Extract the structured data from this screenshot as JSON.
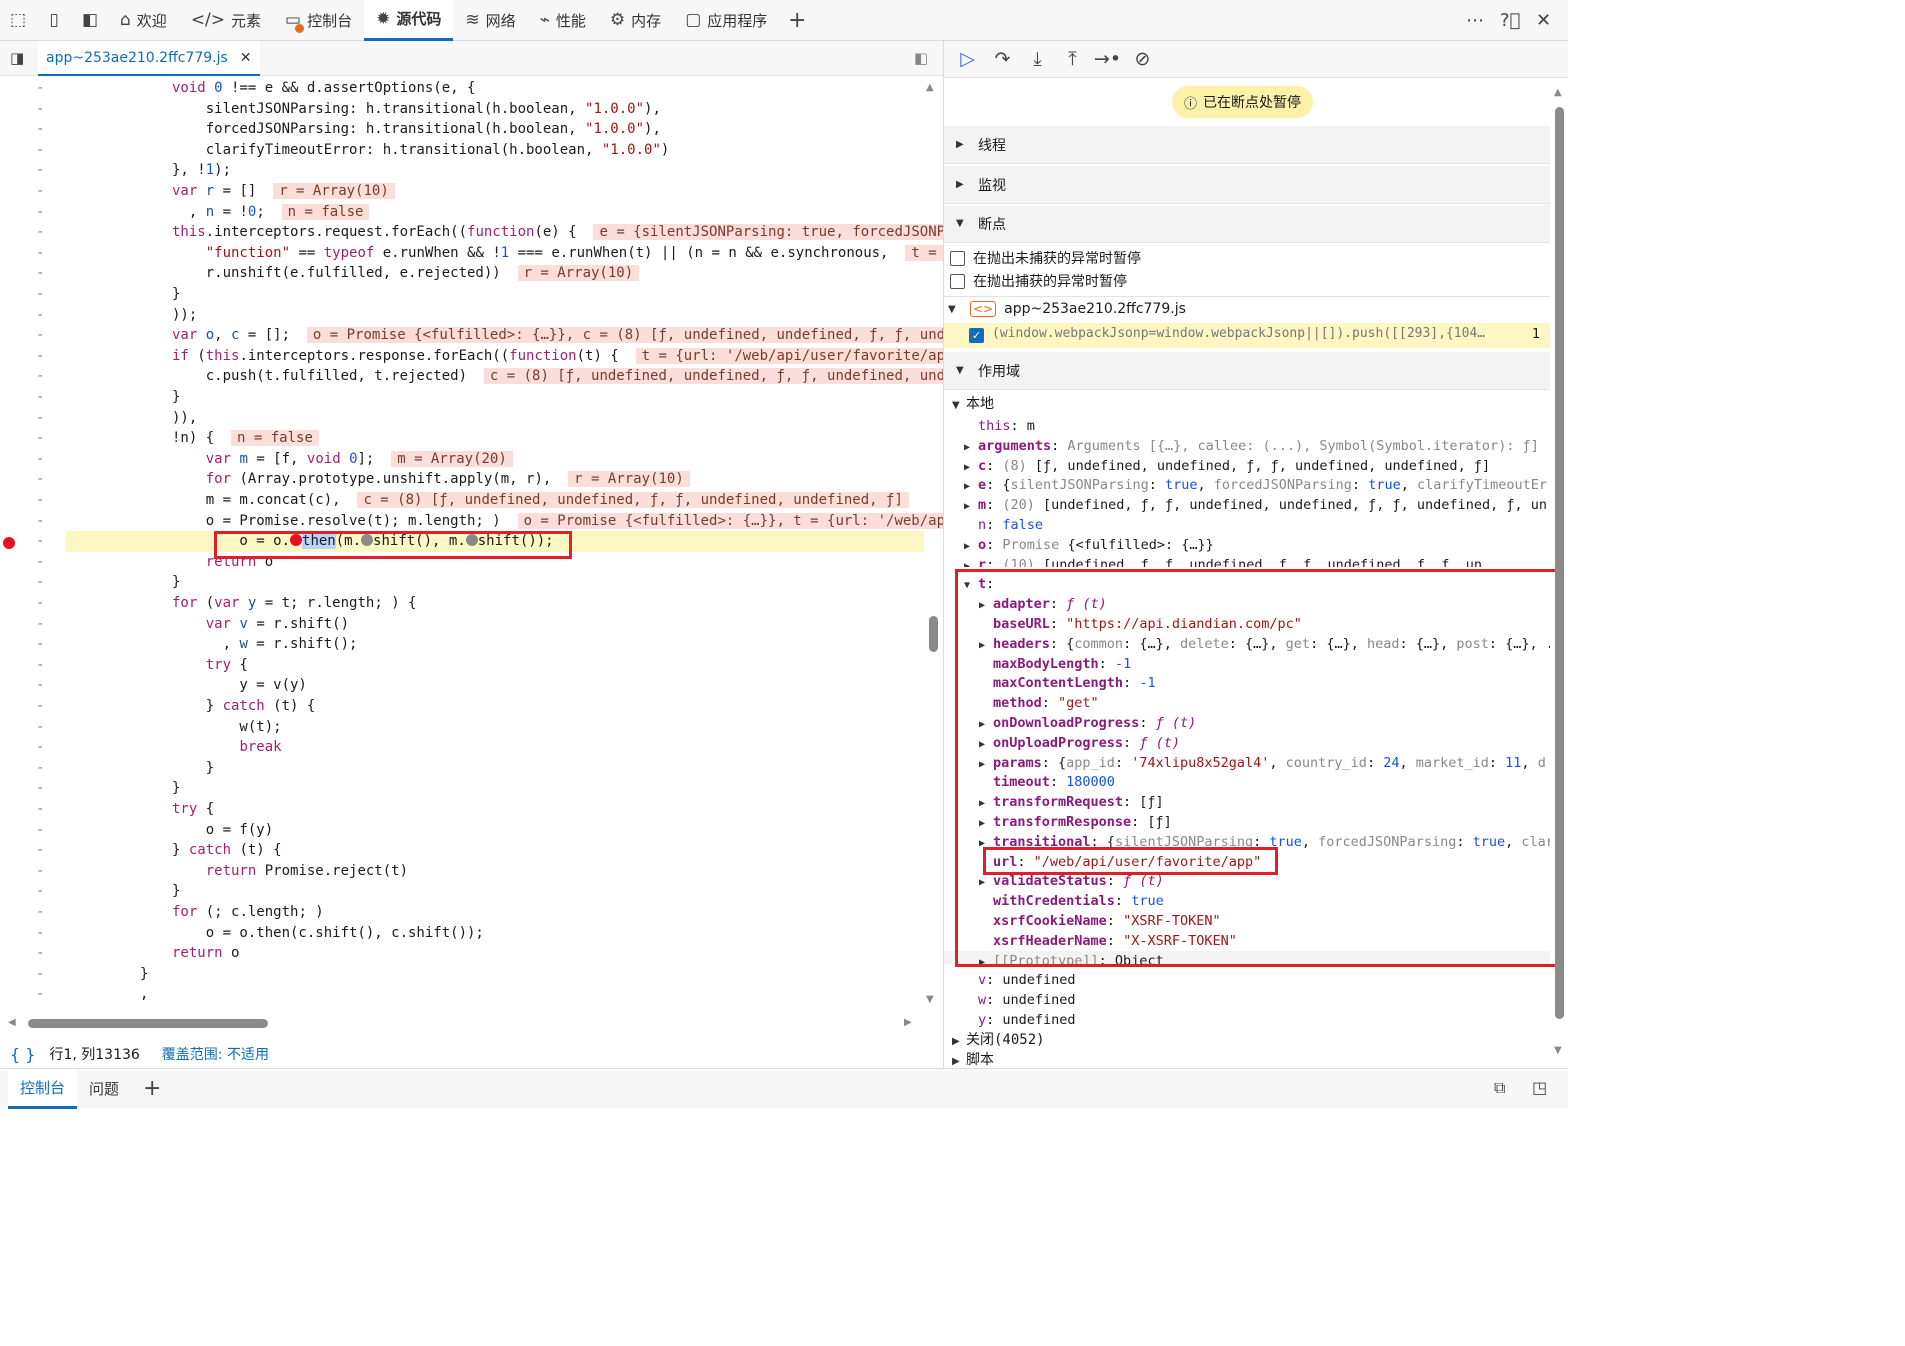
{
  "toolbar": {
    "tabs": [
      {
        "label": "欢迎",
        "icon": "home-icon",
        "glyph": "⌂"
      },
      {
        "label": "元素",
        "icon": "code-tag-icon",
        "glyph": "</>"
      },
      {
        "label": "控制台",
        "icon": "console-icon",
        "glyph": "▭"
      },
      {
        "label": "源代码",
        "icon": "bug-icon",
        "glyph": "✹"
      },
      {
        "label": "网络",
        "icon": "wifi-icon",
        "glyph": "≋"
      },
      {
        "label": "性能",
        "icon": "performance-icon",
        "glyph": "⌁"
      },
      {
        "label": "内存",
        "icon": "memory-icon",
        "glyph": "⚙"
      },
      {
        "label": "应用程序",
        "icon": "application-icon",
        "glyph": "▢"
      }
    ],
    "active_tab": "源代码",
    "add_tab": "+"
  },
  "file_tab": {
    "name": "app~253ae210.2ffc779.js",
    "close": "✕"
  },
  "code_lines": [
    {
      "html": "<span class=\"kw\">void</span> <span class=\"num\">0</span> !== e && d.assertOptions(e, {"
    },
    {
      "html": "    silentJSONParsing: h.transitional(h.boolean, <span class=\"str\">\"1.0.0\"</span>),"
    },
    {
      "html": "    forcedJSONParsing: h.transitional(h.boolean, <span class=\"str\">\"1.0.0\"</span>),"
    },
    {
      "html": "    clarifyTimeoutError: h.transitional(h.boolean, <span class=\"str\">\"1.0.0\"</span>)"
    },
    {
      "html": "}, !<span class=\"num\">1</span>);"
    },
    {
      "html": "<span class=\"kw\">var</span> <span class=\"blu\">r</span> = []  <span class=\"ival\">r = Array(10)</span>"
    },
    {
      "html": "  , <span class=\"blu\">n</span> = !<span class=\"num\">0</span>;  <span class=\"ival\">n = false</span>"
    },
    {
      "html": "<span class=\"kw\">this</span>.interceptors.request.forEach((<span class=\"kw\">function</span>(e) {  <span class=\"ival\">e = {silentJSONParsing: true, forcedJSONPa</span>"
    },
    {
      "html": "    <span class=\"str\">\"function\"</span> == <span class=\"kw\">typeof</span> e.runWhen && !<span class=\"num\">1</span> === e.runWhen(t) || (n = n && e.synchronous,  <span class=\"ival\">t = {</span>"
    },
    {
      "html": "    r.unshift(e.fulfilled, e.rejected))  <span class=\"ival\">r = Array(10)</span>"
    },
    {
      "html": "}"
    },
    {
      "html": "));"
    },
    {
      "html": "<span class=\"kw\">var</span> <span class=\"blu\">o</span>, <span class=\"blu\">c</span> = [];  <span class=\"ival\">o = Promise {&lt;fulfilled&gt;: {…}}, c = (8) [ƒ, undefined, undefined, ƒ, ƒ, unde</span>"
    },
    {
      "html": "<span class=\"kw\">if</span> (<span class=\"kw\">this</span>.interceptors.response.forEach((<span class=\"kw\">function</span>(t) {  <span class=\"ival\">t = {url: '/web/api/user/favorite/app</span>"
    },
    {
      "html": "    c.push(t.fulfilled, t.rejected)  <span class=\"ival\">c = (8) [ƒ, undefined, undefined, ƒ, ƒ, undefined, unde</span>"
    },
    {
      "html": "}"
    },
    {
      "html": ")),"
    },
    {
      "html": "!n) {  <span class=\"ival\">n = false</span>"
    },
    {
      "html": "    <span class=\"kw\">var</span> <span class=\"blu\">m</span> = [f, <span class=\"kw\">void</span> <span class=\"num\">0</span>];  <span class=\"ival\">m = Array(20)</span>"
    },
    {
      "html": "    <span class=\"kw\">for</span> (Array.prototype.unshift.apply(m, r),  <span class=\"ival\">r = Array(10)</span>"
    },
    {
      "html": "    m = m.concat(c),  <span class=\"ival\">c = (8) [ƒ, undefined, undefined, ƒ, ƒ, undefined, undefined, ƒ]</span>"
    },
    {
      "html": "    o = Promise.resolve(t); m.length; )  <span class=\"ival\">o = Promise {&lt;fulfilled&gt;: {…}}, t = {url: '/web/api</span>"
    },
    {
      "html": "        o = o.<span class=\"inlbp\" style=\"background:#e81123\"></span><span style=\"background:#b9d4f7\">then</span>(m.<span class=\"inlbp\" style=\"background:#8a8a8a\"></span>shift(), m.<span class=\"inlbp\" style=\"background:#8a8a8a\"></span>shift());",
      "hl": true
    },
    {
      "html": "    <span class=\"kw\">return</span> o"
    },
    {
      "html": "}"
    },
    {
      "html": "<span class=\"kw\">for</span> (<span class=\"kw\">var</span> <span class=\"blu\">y</span> = t; r.length; ) {"
    },
    {
      "html": "    <span class=\"kw\">var</span> <span class=\"blu\">v</span> = r.shift()"
    },
    {
      "html": "      , <span class=\"blu\">w</span> = r.shift();"
    },
    {
      "html": "    <span class=\"kw\">try</span> {"
    },
    {
      "html": "        y = v(y)"
    },
    {
      "html": "    } <span class=\"kw\">catch</span> (t) {"
    },
    {
      "html": "        w(t);"
    },
    {
      "html": "        <span class=\"kw\">break</span>"
    },
    {
      "html": "    }"
    },
    {
      "html": "}"
    },
    {
      "html": "<span class=\"kw\">try</span> {"
    },
    {
      "html": "    o = f(y)"
    },
    {
      "html": "} <span class=\"kw\">catch</span> (t) {"
    },
    {
      "html": "    <span class=\"kw\">return</span> Promise.reject(t)"
    },
    {
      "html": "}"
    },
    {
      "html": "<span class=\"kw\">for</span> (; c.length; )"
    },
    {
      "html": "    o = o.then(c.shift(), c.shift());"
    },
    {
      "html": "<span class=\"kw\">return</span> o"
    },
    {
      "html": "}",
      "indent": -32
    },
    {
      "html": ",",
      "indent": -32
    }
  ],
  "gutter_mark": "-",
  "status": {
    "braces": "{ }",
    "position": "行1, 列13136",
    "coverage": "覆盖范围: 不适用"
  },
  "debugger": {
    "paused": "已在断点处暂停",
    "sections": {
      "threads": "线程",
      "watch": "监视",
      "breakpoints": "断点",
      "scope": "作用域"
    },
    "pause_uncaught": "在抛出未捕获的异常时暂停",
    "pause_caught": "在抛出捕获的异常时暂停",
    "bp_file": "app~253ae210.2ffc779.js",
    "bp_code": "(window.webpackJsonp=window.webpackJsonp||[]).push([[293],{104…",
    "bp_line": "1",
    "local": "本地",
    "closure": "关闭(4052)",
    "script": "脚本"
  },
  "scope_rows": [
    {
      "html": "<span class=\"pk2\">this</span>: m",
      "d": 1,
      "a": ""
    },
    {
      "html": "<span class=\"pk\">arguments</span>: <span class=\"pg\">Arguments [{…}, callee: (...), Symbol(Symbol.iterator): ƒ]</span>",
      "d": 1,
      "a": "▶"
    },
    {
      "html": "<span class=\"pk\">c</span>: <span class=\"pg\">(8)</span> [ƒ, undefined, undefined, ƒ, ƒ, undefined, undefined, ƒ]",
      "d": 1,
      "a": "▶"
    },
    {
      "html": "<span class=\"pk\">e</span>: {<span class=\"pg\">silentJSONParsing</span>: <span class=\"pv\">true</span>, <span class=\"pg\">forcedJSONParsing</span>: <span class=\"pv\">true</span>, <span class=\"pg\">clarifyTimeoutEr</span>",
      "d": 1,
      "a": "▶"
    },
    {
      "html": "<span class=\"pk\">m</span>: <span class=\"pg\">(20)</span> [undefined, ƒ, ƒ, undefined, undefined, ƒ, ƒ, undefined, ƒ, un",
      "d": 1,
      "a": "▶"
    },
    {
      "html": "<span class=\"pk2\">n</span>: <span class=\"pv\">false</span>",
      "d": 1,
      "a": ""
    },
    {
      "html": "<span class=\"pk\">o</span>: <span class=\"pg\">Promise</span> {&lt;fulfilled&gt;: {…}}",
      "d": 1,
      "a": "▶"
    },
    {
      "html": "<span class=\"pk\">r</span>: <span class=\"pg\">(10)</span> [undefined, ƒ, ƒ, undefined, ƒ, ƒ, undefined, ƒ, ƒ, un",
      "d": 1,
      "a": "▶"
    },
    {
      "html": "<span class=\"pk\">t</span>:",
      "d": 1,
      "a": "▼"
    },
    {
      "html": "<span class=\"pk\">adapter</span>: <i class=\"pk2\">ƒ (t)</i>",
      "d": 2,
      "a": "▶"
    },
    {
      "html": "<span class=\"pk\">baseURL</span>: <span class=\"ps\">\"https://api.diandian.com/pc\"</span>",
      "d": 2,
      "a": ""
    },
    {
      "html": "<span class=\"pk\">headers</span>: {<span class=\"pg\">common</span>: {…}, <span class=\"pg\">delete</span>: {…}, <span class=\"pg\">get</span>: {…}, <span class=\"pg\">head</span>: {…}, <span class=\"pg\">post</span>: {…}, .",
      "d": 2,
      "a": "▶"
    },
    {
      "html": "<span class=\"pk\">maxBodyLength</span>: <span class=\"pv\">-1</span>",
      "d": 2,
      "a": ""
    },
    {
      "html": "<span class=\"pk\">maxContentLength</span>: <span class=\"pv\">-1</span>",
      "d": 2,
      "a": ""
    },
    {
      "html": "<span class=\"pk\">method</span>: <span class=\"ps\">\"get\"</span>",
      "d": 2,
      "a": ""
    },
    {
      "html": "<span class=\"pk\">onDownloadProgress</span>: <i class=\"pk2\">ƒ (t)</i>",
      "d": 2,
      "a": "▶"
    },
    {
      "html": "<span class=\"pk\">onUploadProgress</span>: <i class=\"pk2\">ƒ (t)</i>",
      "d": 2,
      "a": "▶"
    },
    {
      "html": "<span class=\"pk\">params</span>: {<span class=\"pg\">app_id</span>: <span class=\"ps\">'74xlipu8x52gal4'</span>, <span class=\"pg\">country_id</span>: <span class=\"pv\">24</span>, <span class=\"pg\">market_id</span>: <span class=\"pv\">11</span>, <span class=\"pg\">d</span>",
      "d": 2,
      "a": "▶"
    },
    {
      "html": "<span class=\"pk\">timeout</span>: <span class=\"pv\">180000</span>",
      "d": 2,
      "a": ""
    },
    {
      "html": "<span class=\"pk\">transformRequest</span>: [ƒ]",
      "d": 2,
      "a": "▶"
    },
    {
      "html": "<span class=\"pk\">transformResponse</span>: [ƒ]",
      "d": 2,
      "a": "▶"
    },
    {
      "html": "<span class=\"pk\">transitional</span>: {<span class=\"pg\">silentJSONParsing</span>: <span class=\"pv\">true</span>, <span class=\"pg\">forcedJSONParsing</span>: <span class=\"pv\">true</span>, <span class=\"pg\">clar</span>",
      "d": 2,
      "a": "▶"
    },
    {
      "html": "<span class=\"pk\">url</span>: <span class=\"ps\">\"/web/api/user/favorite/app\"</span>",
      "d": 2,
      "a": ""
    },
    {
      "html": "<span class=\"pk\">validateStatus</span>: <i class=\"pk2\">ƒ (t)</i>",
      "d": 2,
      "a": "▶"
    },
    {
      "html": "<span class=\"pk\">withCredentials</span>: <span class=\"pv\">true</span>",
      "d": 2,
      "a": ""
    },
    {
      "html": "<span class=\"pk\">xsrfCookieName</span>: <span class=\"ps\">\"XSRF-TOKEN\"</span>",
      "d": 2,
      "a": ""
    },
    {
      "html": "<span class=\"pk\">xsrfHeaderName</span>: <span class=\"ps\">\"X-XSRF-TOKEN\"</span>",
      "d": 2,
      "a": ""
    },
    {
      "html": "<span class=\"pg\">[[Prototype]]</span>: Object",
      "d": 2,
      "a": "▶"
    },
    {
      "html": "<span class=\"pk2\">v</span>: undefined",
      "d": 1,
      "a": ""
    },
    {
      "html": "<span class=\"pk2\">w</span>: undefined",
      "d": 1,
      "a": ""
    },
    {
      "html": "<span class=\"pk2\">y</span>: undefined",
      "d": 1,
      "a": ""
    }
  ],
  "bottom": {
    "tabs": [
      "控制台",
      "问题"
    ],
    "add": "+"
  },
  "colors": {
    "accent": "#0f6cbd",
    "breakpoint": "#e81123",
    "highlight_box": "#e01f2b",
    "paused_bg": "#fbf1a8",
    "inline_value_bg": "#fbded9"
  }
}
